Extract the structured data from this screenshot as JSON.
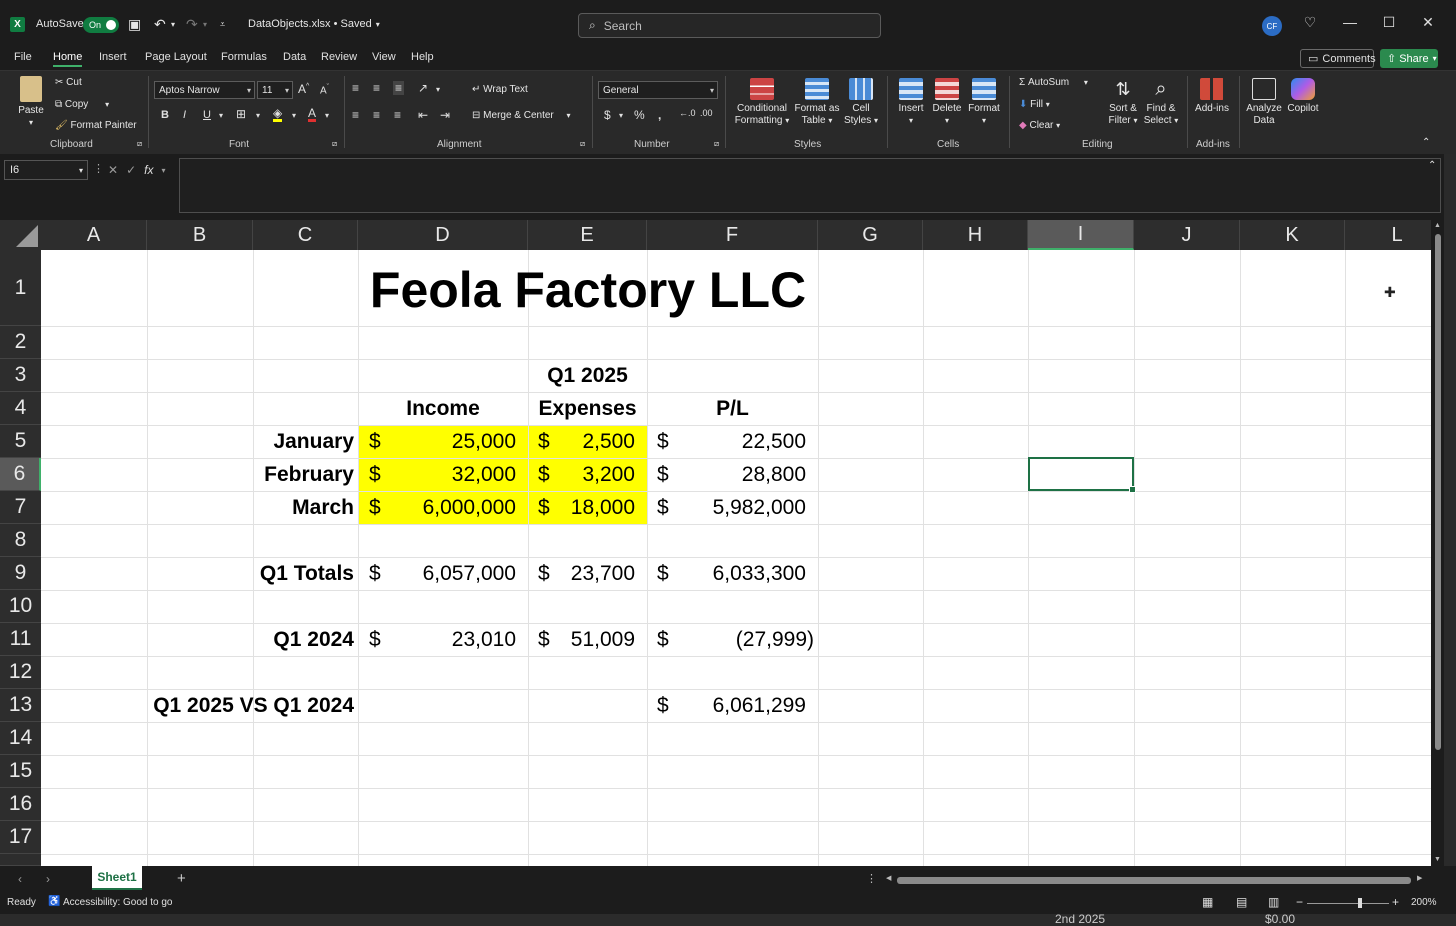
{
  "titlebar": {
    "autosave_label": "AutoSave",
    "autosave_state": "On",
    "filename": "DataObjects.xlsx • Saved",
    "search_placeholder": "Search",
    "avatar_initials": "CF"
  },
  "menu": {
    "tabs": [
      "File",
      "Home",
      "Insert",
      "Page Layout",
      "Formulas",
      "Data",
      "Review",
      "View",
      "Help"
    ],
    "active": "Home",
    "comments": "Comments",
    "share": "Share"
  },
  "ribbon": {
    "clipboard": {
      "label": "Clipboard",
      "paste": "Paste",
      "cut": "Cut",
      "copy": "Copy",
      "format_painter": "Format Painter"
    },
    "font": {
      "label": "Font",
      "family": "Aptos Narrow",
      "size": "11"
    },
    "alignment": {
      "label": "Alignment",
      "wrap": "Wrap Text",
      "merge": "Merge & Center"
    },
    "number": {
      "label": "Number",
      "format": "General"
    },
    "styles": {
      "label": "Styles",
      "conditional": "Conditional Formatting",
      "conditional_l1": "Conditional",
      "conditional_l2": "Formatting",
      "format_table_l1": "Format as",
      "format_table_l2": "Table",
      "cell_styles_l1": "Cell",
      "cell_styles_l2": "Styles"
    },
    "cells": {
      "label": "Cells",
      "insert": "Insert",
      "delete": "Delete",
      "format": "Format"
    },
    "editing": {
      "label": "Editing",
      "autosum": "AutoSum",
      "fill": "Fill",
      "clear": "Clear",
      "sort_l1": "Sort &",
      "sort_l2": "Filter",
      "find_l1": "Find &",
      "find_l2": "Select"
    },
    "addins": {
      "label": "Add-ins",
      "addins": "Add-ins",
      "analyze_l1": "Analyze",
      "analyze_l2": "Data",
      "copilot": "Copilot"
    }
  },
  "formula_bar": {
    "name_box": "I6",
    "formula": ""
  },
  "columns": [
    "A",
    "B",
    "C",
    "D",
    "E",
    "F",
    "G",
    "H",
    "I",
    "J",
    "K",
    "L"
  ],
  "rows": [
    "1",
    "2",
    "3",
    "4",
    "5",
    "6",
    "7",
    "8",
    "9",
    "10",
    "11",
    "12",
    "13",
    "14",
    "15",
    "16",
    "17"
  ],
  "selected_cell": {
    "column": "I",
    "row": "6"
  },
  "sheet": {
    "title": "Feola Factory LLC",
    "period_header": "Q1 2025",
    "headers": {
      "income": "Income",
      "expenses": "Expenses",
      "pl": "P/L"
    },
    "data_rows": [
      {
        "label": "January",
        "income": "25,000",
        "expenses": "2,500",
        "pl": "22,500"
      },
      {
        "label": "February",
        "income": "32,000",
        "expenses": "3,200",
        "pl": "28,800"
      },
      {
        "label": "March",
        "income": "6,000,000",
        "expenses": "18,000",
        "pl": "5,982,000"
      }
    ],
    "totals": {
      "label": "Q1 Totals",
      "income": "6,057,000",
      "expenses": "23,700",
      "pl": "6,033,300"
    },
    "prior": {
      "label": "Q1 2024",
      "income": "23,010",
      "expenses": "51,009",
      "pl": "(27,999)"
    },
    "comparison": {
      "label": "Q1 2025 VS Q1 2024",
      "pl": "6,061,299"
    },
    "currency": "$",
    "highlight_color": "#ffff00"
  },
  "tabs": {
    "sheets": [
      "Sheet1"
    ],
    "add": "+"
  },
  "status": {
    "ready": "Ready",
    "accessibility": "Accessibility: Good to go",
    "zoom": "200%"
  },
  "background_peek": {
    "text1": "2nd 2025",
    "text2": "$0.00"
  },
  "colors": {
    "accent": "#107c41",
    "selection": "#1e7145",
    "dark_bg": "#1c1c1c"
  }
}
